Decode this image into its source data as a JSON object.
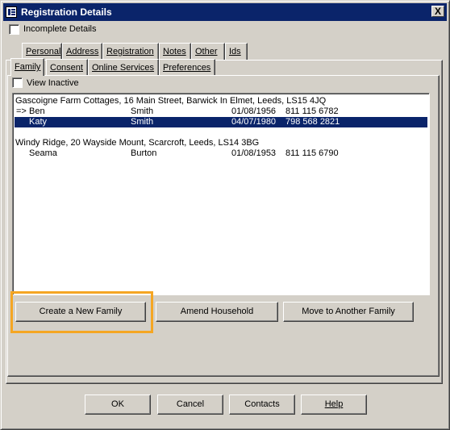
{
  "window": {
    "title": "Registration Details",
    "close_label": "X"
  },
  "incomplete_details": {
    "label": "Incomplete Details",
    "checked": false
  },
  "tabs_row1": [
    "Personal",
    "Address",
    "Registration",
    "Notes",
    "Other",
    "Ids"
  ],
  "tabs_row2": [
    "Family",
    "Consent",
    "Online Services",
    "Preferences"
  ],
  "view_inactive": {
    "label": "View Inactive",
    "checked": false
  },
  "families": [
    {
      "address": "Gascoigne Farm Cottages, 16 Main Street, Barwick In Elmet, Leeds, LS15 4JQ",
      "members": [
        {
          "marker": "=>",
          "first": "Ben",
          "last": "Smith",
          "dob": "01/08/1956",
          "nhs": "811 115 6782",
          "selected": false
        },
        {
          "marker": "",
          "first": "Katy",
          "last": "Smith",
          "dob": "04/07/1980",
          "nhs": "798 568 2821",
          "selected": true
        }
      ]
    },
    {
      "address": "Windy Ridge, 20 Wayside Mount, Scarcroft, Leeds, LS14 3BG",
      "members": [
        {
          "marker": "",
          "first": "Seama",
          "last": "Burton",
          "dob": "01/08/1953",
          "nhs": "811 115 6790",
          "selected": false
        }
      ]
    }
  ],
  "family_buttons": {
    "create": "Create a New Family",
    "amend": "Amend Household",
    "move": "Move to Another Family"
  },
  "footer_buttons": {
    "ok": "OK",
    "cancel": "Cancel",
    "contacts": "Contacts",
    "help": "Help"
  }
}
